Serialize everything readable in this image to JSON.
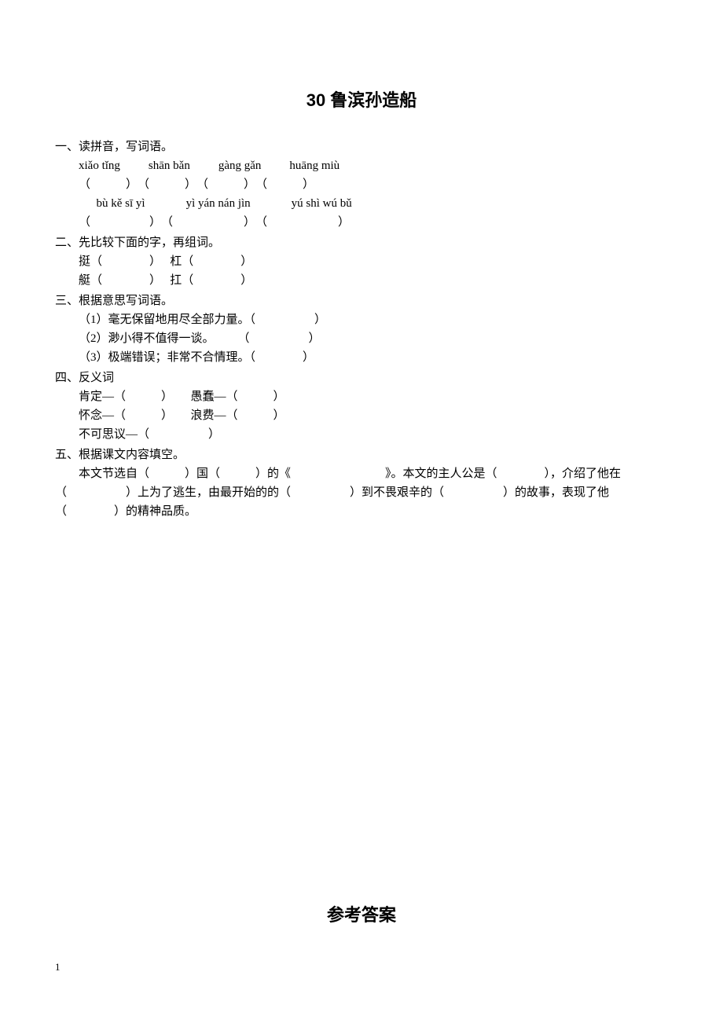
{
  "title": "30 鲁滨孙造船",
  "section1": {
    "head": "一、读拼音，写词语。",
    "row1": {
      "p1": "xiǎo tǐng",
      "p2": "shān bǎn",
      "p3": "gàng gǎn",
      "p4": "huāng miù"
    },
    "row1_blanks": "（　　　）　（　　　）　（　　　）　（　　　）",
    "row2": {
      "p1": "bù kě sī yì",
      "p2": "yì yán nán jìn",
      "p3": "yú shì wú bǔ"
    },
    "row2_blanks": "（　　　　　）　（　　　　　　）　（　　　　　　）"
  },
  "section2": {
    "head": "二、先比较下面的字，再组词。",
    "r1": "挺（　　　　）　 杠（　　　　）",
    "r2": "艇（　　　　）　 扛（　　　　）"
  },
  "section3": {
    "head": "三、根据意思写词语。",
    "i1": "（1）毫无保留地用尽全部力量。（　　　　　）",
    "i2": "（2）渺小得不值得一谈。　　　（　　　　　）",
    "i3": "（3）极端错误；非常不合情理。（　　　　）"
  },
  "section4": {
    "head": "四、反义词",
    "r1": "肯定—（　　　）　　愚蠢—（　　　）",
    "r2": "怀念—（　　　）　　浪费—（　　　）",
    "r3": "不可思议—（　　　　　）"
  },
  "section5": {
    "head": "五、根据课文内容填空。",
    "para": "　　本文节选自（　　　）国（　　　）的《　　　　　　　　》。本文的主人公是（　　　　），介绍了他在（　　　　　）上为了逃生，由最开始的的（　　　　　）到不畏艰辛的（　　　　　）的故事，表现了他（　　　　）的精神品质。"
  },
  "answer_title": "参考答案",
  "page_number": "1"
}
